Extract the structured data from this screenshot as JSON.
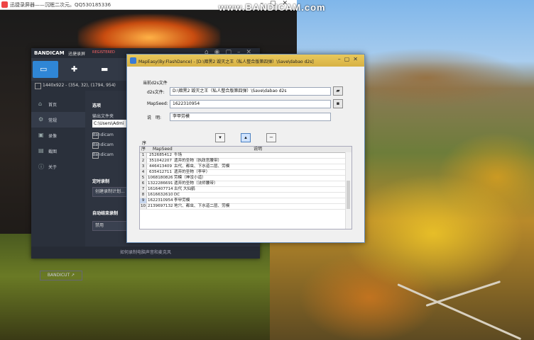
{
  "desktop": {
    "top_title": "迅捷录屏器——沉眠二次元。QQ530185336",
    "watermark": "www.BANDICAM.com"
  },
  "bandicam": {
    "logo": "BANDICAM",
    "title": "迅捷录屏",
    "registered": "REGISTERED",
    "resolution": "1440x922 - (354, 32), (1794, 954)",
    "sidebar": [
      {
        "label": "首页",
        "icon": "home-icon"
      },
      {
        "label": "常规",
        "icon": "gear-icon"
      },
      {
        "label": "录像",
        "icon": "video-icon"
      },
      {
        "label": "截图",
        "icon": "image-icon"
      },
      {
        "label": "关于",
        "icon": "info-icon"
      }
    ],
    "bandicut": "BANDICUT ↗",
    "main": {
      "section": "选项",
      "output_folder_label": "输出文件夹",
      "output_folder_value": "C:\\Users\\Admi",
      "checkbox_1": "Bandicam",
      "checkbox_2": "Bandicam",
      "checkbox_3": "Bandicam",
      "timer_label": "定时录制",
      "timer_select": "创建录制计划...",
      "auto_stop_label": "自动结束录制",
      "auto_stop_select": "禁用"
    },
    "footer": "如何录制电脑声音和麦克风"
  },
  "mapeasy": {
    "title": "MapEasy(By:FlashDance) - [D:\\暗黑2 毁灭之王（私人整合版第四弹）\\Save\\dabao d2s]",
    "current_file_label": "当前d2s文件",
    "d2s_label": "d2s文件:",
    "d2s_value": "D:\\暗黑2 毁灭之王（私人整合版第四弹）\\Save\\dabao d2s",
    "mapseed_label": "MapSeed:",
    "mapseed_value": "1622310954",
    "desc_label": "说　明:",
    "desc_value": "李甲劳模",
    "table": {
      "headers": [
        "序",
        "MapSeed",
        "说明"
      ],
      "rows": [
        {
          "n": "1",
          "seed": "252685412",
          "desc": "牛场"
        },
        {
          "n": "2",
          "seed": "351042207",
          "desc": "遗弃的圣物（执政官腰带）"
        },
        {
          "n": "3",
          "seed": "446413409",
          "desc": "古代、都虫、下水道二层、劳模"
        },
        {
          "n": "4",
          "seed": "635412711",
          "desc": "遗弃的圣物（李甲）"
        },
        {
          "n": "5",
          "seed": "1068180826",
          "desc": "劳模（神没小道）"
        },
        {
          "n": "6",
          "seed": "1322286691",
          "desc": "遗弃的圣物（法师腰带）"
        },
        {
          "n": "7",
          "seed": "1616407714",
          "desc": "古代 大仙鹤"
        },
        {
          "n": "8",
          "seed": "1616632610",
          "desc": "DC"
        },
        {
          "n": "9",
          "seed": "1622310954",
          "desc": "李甲劳模"
        },
        {
          "n": "10",
          "seed": "2139697132",
          "desc": "地穴、都虫、下水道二层、劳模"
        }
      ]
    }
  }
}
